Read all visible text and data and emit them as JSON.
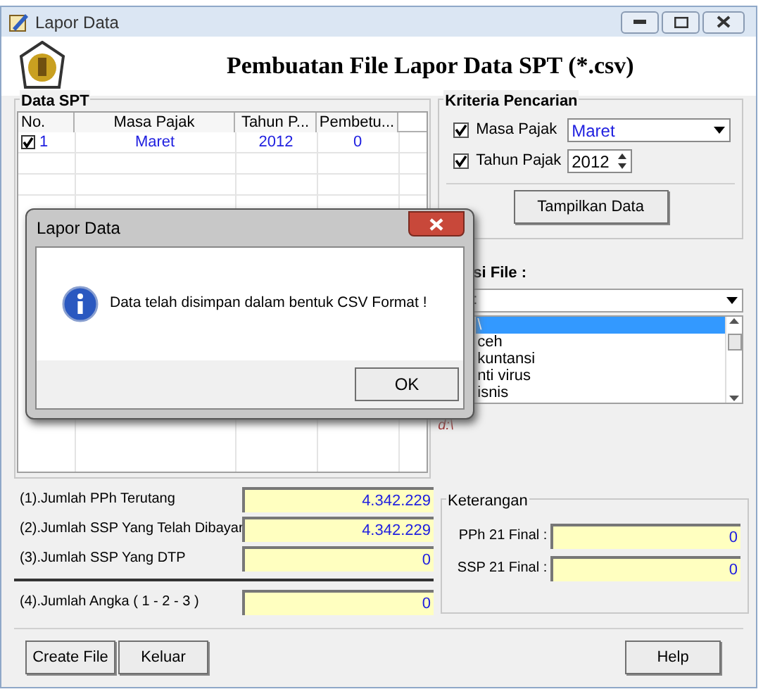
{
  "window": {
    "title": "Lapor Data",
    "heading": "Pembuatan File Lapor Data SPT (*.csv)"
  },
  "data_spt": {
    "title": "Data SPT",
    "columns": [
      "No.",
      "Masa Pajak",
      "Tahun P...",
      "Pembetu..."
    ],
    "rows": [
      {
        "checked": true,
        "cells": [
          "1",
          "Maret",
          "2012",
          "0"
        ]
      }
    ]
  },
  "kriteria": {
    "title": "Kriteria Pencarian",
    "fields": [
      {
        "kind": "dropdown",
        "label": "Masa Pajak",
        "checked": true,
        "value": "Maret"
      },
      {
        "kind": "spinner",
        "label": "Tahun Pajak",
        "checked": true,
        "value": "2012"
      }
    ],
    "button": "Tampilkan Data"
  },
  "lokasi": {
    "label": "si File :",
    "drive": ":",
    "folders": [
      {
        "label": "\\",
        "selected": true
      },
      {
        "label": "ceh",
        "selected": false
      },
      {
        "label": "kuntansi",
        "selected": false
      },
      {
        "label": "nti virus",
        "selected": false
      },
      {
        "label": "isnis",
        "selected": false
      }
    ],
    "path": "d:\\"
  },
  "summary": [
    {
      "label": "(1).Jumlah PPh Terutang",
      "value": "4.342.229"
    },
    {
      "label": "(2).Jumlah SSP Yang Telah Dibayar",
      "value": "4.342.229"
    },
    {
      "label": "(3).Jumlah SSP Yang DTP",
      "value": "0"
    },
    {
      "label": "(4).Jumlah Angka ( 1 - 2 - 3 )",
      "value": "0"
    }
  ],
  "keterangan": {
    "title": "Keterangan",
    "fields": [
      {
        "label": "PPh 21 Final :",
        "value": "0"
      },
      {
        "label": "SSP 21 Final :",
        "value": "0"
      }
    ]
  },
  "buttons": [
    "Create File",
    "Keluar",
    "Help"
  ],
  "dialog": {
    "title": "Lapor Data",
    "message": "Data telah disimpan dalam bentuk CSV Format !",
    "button": "OK"
  }
}
